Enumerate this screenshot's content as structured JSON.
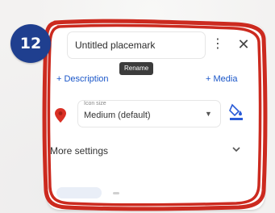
{
  "step": {
    "number": "12"
  },
  "placemark": {
    "title": "Untitled placemark",
    "tooltip": "Rename",
    "more_icon": "vertical-dots-icon",
    "close_icon": "close-icon"
  },
  "links": {
    "description": "+ Description",
    "media": "+ Media"
  },
  "icon_size": {
    "label": "Icon size",
    "value": "Medium (default)",
    "pin_color": "#d93025",
    "fill_icon": "paint-bucket-icon"
  },
  "more_settings": {
    "label": "More settings"
  },
  "colors": {
    "badge": "#1f3f8f",
    "highlight": "#cc2a1f",
    "link": "#1a56c8"
  }
}
